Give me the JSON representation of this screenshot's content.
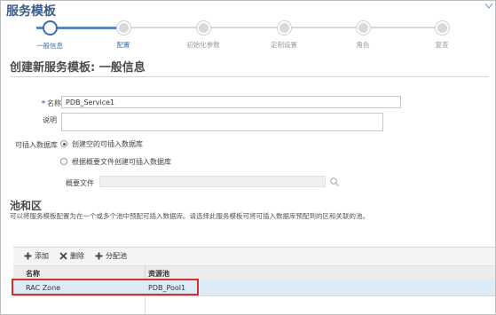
{
  "page": {
    "title": "服务模板"
  },
  "train": {
    "steps": [
      {
        "label": "一般信息",
        "state": "current"
      },
      {
        "label": "配置",
        "state": "next"
      },
      {
        "label": "初始化参数",
        "state": "pending"
      },
      {
        "label": "定制设置",
        "state": "pending"
      },
      {
        "label": "角色",
        "state": "pending"
      },
      {
        "label": "复查",
        "state": "pending"
      }
    ]
  },
  "form": {
    "heading": "创建新服务模板: 一般信息",
    "required_mark": "*",
    "name_label": "名称",
    "name_value": "PDB_Service1",
    "description_label": "说明",
    "description_value": "",
    "pdb_label": "可插入数据库",
    "option_create_empty": "创建空的可插入数据库",
    "option_from_profile": "根据概要文件创建可插入数据库",
    "selected_option": "create_empty",
    "profile_label": "概要文件",
    "profile_value": ""
  },
  "pool": {
    "heading": "池和区",
    "description": "可以将服务模板配置为在一个或多个池中预配可插入数据库。请选择此服务模板可将可插入数据库预配到的区和关联的池。"
  },
  "toolbar": {
    "add_label": "添加",
    "delete_label": "删除",
    "assign_pool_label": "分配池"
  },
  "table": {
    "columns": [
      "名称",
      "资源池"
    ],
    "rows": [
      {
        "name": "RAC Zone",
        "pool": "PDB_Pool1"
      }
    ]
  },
  "colors": {
    "accent": "#3d6ea8",
    "selected_row": "#dcebf5",
    "highlight": "#d32f2f"
  }
}
